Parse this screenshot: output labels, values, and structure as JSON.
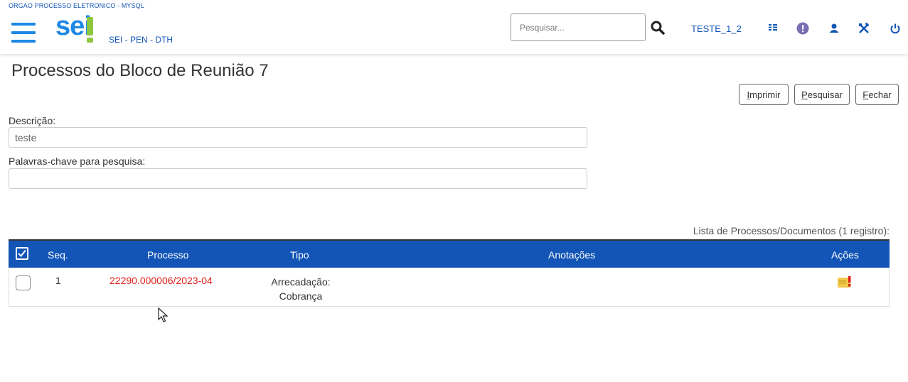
{
  "header": {
    "org": "ORGAO PROCESSO ELETRONICO - MYSQL",
    "logo": "sei!",
    "unit": "SEI - PEN - DTH",
    "search_placeholder": "Pesquisar...",
    "user": "TESTE_1_2",
    "icons": [
      "menu-icon",
      "search-icon",
      "blocks-icon",
      "alert-icon",
      "user-icon",
      "tools-icon",
      "power-icon"
    ],
    "brand_color": "#1e88e5",
    "accent_color": "#8dc63f"
  },
  "page": {
    "title": "Processos do Bloco de Reunião 7",
    "buttons": {
      "print": {
        "first": "I",
        "rest": "mprimir"
      },
      "search": {
        "first": "P",
        "rest": "esquisar"
      },
      "close": {
        "first": "F",
        "rest": "echar"
      }
    }
  },
  "form": {
    "description_label": "Descrição:",
    "description_value": "teste",
    "keywords_label": "Palavras-chave para pesquisa:",
    "keywords_value": ""
  },
  "table": {
    "caption": "Lista de Processos/Documentos (1 registro):",
    "header_color": "#1255b6",
    "columns": [
      "Seq.",
      "Processo",
      "Tipo",
      "Anotações",
      "Ações"
    ],
    "rows": [
      {
        "seq": "1",
        "processo": "22290.000006/2023-04",
        "tipo_line1": "Arrecadação:",
        "tipo_line2": "Cobrança",
        "anotacoes": "",
        "acao_icon": "annotation-alert-icon"
      }
    ]
  }
}
